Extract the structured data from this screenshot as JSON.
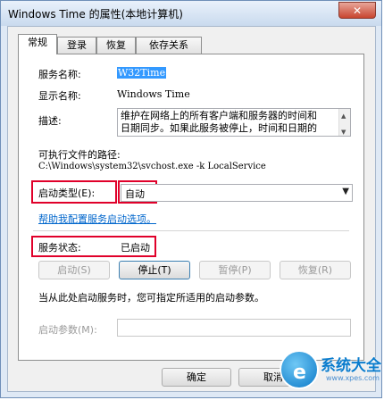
{
  "window": {
    "title": "Windows Time 的属性(本地计算机)",
    "close_glyph": "✕"
  },
  "tabs": [
    {
      "label": "常规",
      "active": true
    },
    {
      "label": "登录"
    },
    {
      "label": "恢复"
    },
    {
      "label": "依存关系"
    }
  ],
  "general": {
    "service_name_label": "服务名称:",
    "service_name_value": "W32Time",
    "display_name_label": "显示名称:",
    "display_name_value": "Windows Time",
    "description_label": "描述:",
    "description_line1": "维护在网络上的所有客户端和服务器的时间和",
    "description_line2": "日期同步。如果此服务被停止，时间和日期的",
    "path_label": "可执行文件的路径:",
    "path_value": "C:\\Windows\\system32\\svchost.exe -k LocalService",
    "startup_type_label": "启动类型(E):",
    "startup_type_value": "自动",
    "help_link": "帮助我配置服务启动选项。",
    "status_label": "服务状态:",
    "status_value": "已启动",
    "buttons": {
      "start": "启动(S)",
      "stop": "停止(T)",
      "pause": "暂停(P)",
      "resume": "恢复(R)"
    },
    "hint": "当从此处启动服务时，您可指定所适用的启动参数。",
    "start_params_label": "启动参数(M):",
    "start_params_value": ""
  },
  "footer": {
    "ok": "确定",
    "cancel": "取消"
  },
  "watermark": {
    "brand": "系统大全",
    "url": "www.xpes.com",
    "letter": "e"
  },
  "colors": {
    "highlight": "#e0002a",
    "link": "#0066cc",
    "selection": "#3399ff"
  }
}
